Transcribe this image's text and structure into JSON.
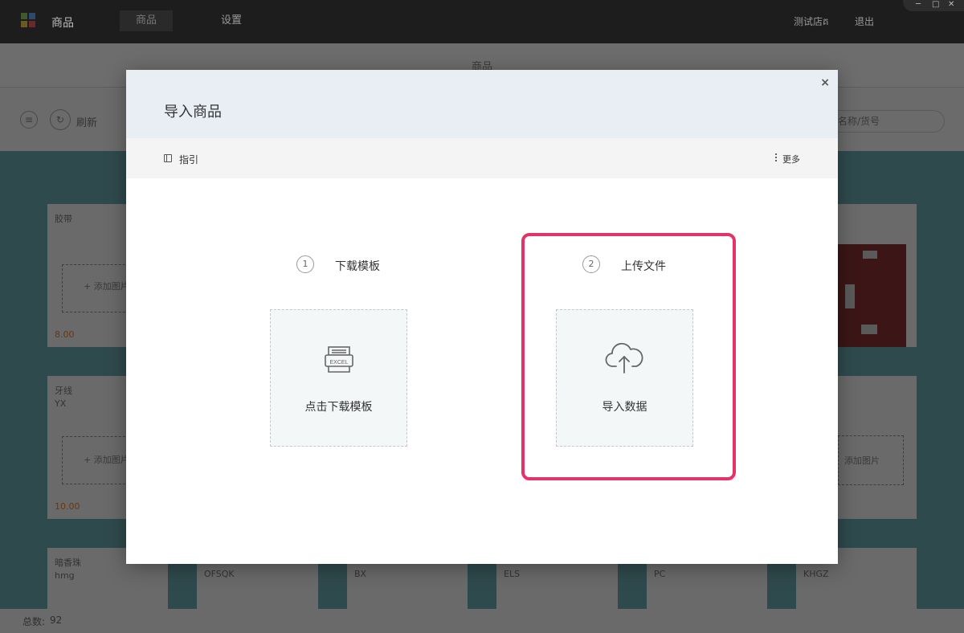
{
  "app": {
    "name": "商品",
    "nav_tabs": [
      {
        "label": "商品"
      },
      {
        "label": "设置"
      }
    ],
    "store_name": "测试店គ",
    "logout_label": "退出",
    "window_controls": {
      "minimize": "─",
      "maximize": "□",
      "close": "✕"
    }
  },
  "page": {
    "title": "商品",
    "refresh_label": "刷新",
    "search_placeholder": "名称/货号"
  },
  "cards": [
    {
      "name": "胶带",
      "code": "",
      "add_label": "+ 添加图片",
      "price": "8.00"
    },
    {
      "name": "牙线",
      "code": "YX",
      "add_label": "+ 添加图片",
      "price": "10.00"
    },
    {
      "name": "暗香珠",
      "code": "hmg",
      "add_label": "",
      "price": ""
    },
    {
      "name": "",
      "code": "OFSQK",
      "add_label": "",
      "price": ""
    },
    {
      "name": "",
      "code": "BX",
      "add_label": "",
      "price": ""
    },
    {
      "name": "",
      "code": "ELS",
      "add_label": "",
      "price": ""
    },
    {
      "name": "",
      "code": "PC",
      "add_label": "",
      "price": ""
    },
    {
      "name": "",
      "code": "KHGZ",
      "add_label": "",
      "price": ""
    },
    {
      "name": "",
      "code": "",
      "add_label": "添加图片",
      "price": ""
    }
  ],
  "status": {
    "total_label": "总数:",
    "total_value": "92"
  },
  "modal": {
    "title": "导入商品",
    "close_label": "×",
    "guide_label": "指引",
    "more_label": "更多",
    "steps": [
      {
        "number": "1",
        "title": "下载模板",
        "button_label": "点击下载模板",
        "icon": "excel-icon",
        "icon_text": "EXCEL"
      },
      {
        "number": "2",
        "title": "上传文件",
        "button_label": "导入数据",
        "icon": "cloud-upload-icon"
      }
    ],
    "highlight_color": "#e5336a"
  }
}
